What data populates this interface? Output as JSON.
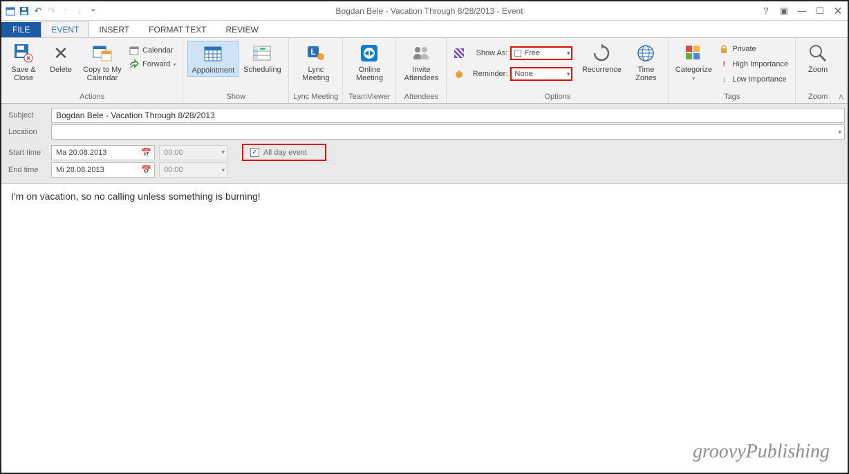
{
  "window": {
    "title": "Bogdan Bele - Vacation Through 8/28/2013 - Event"
  },
  "tabs": {
    "file": "FILE",
    "event": "EVENT",
    "insert": "INSERT",
    "format_text": "FORMAT TEXT",
    "review": "REVIEW"
  },
  "ribbon": {
    "actions": {
      "group": "Actions",
      "save_close": "Save & Close",
      "delete": "Delete",
      "copy_cal": "Copy to My Calendar",
      "calendar": "Calendar",
      "forward": "Forward"
    },
    "show": {
      "group": "Show",
      "appointment": "Appointment",
      "scheduling": "Scheduling"
    },
    "lync": {
      "group": "Lync Meeting",
      "btn": "Lync Meeting"
    },
    "tv": {
      "group": "TeamViewer",
      "btn": "Online Meeting"
    },
    "attendees": {
      "group": "Attendees",
      "btn": "Invite Attendees"
    },
    "options": {
      "group": "Options",
      "show_as_lbl": "Show As:",
      "show_as_val": "Free",
      "reminder_lbl": "Reminder:",
      "reminder_val": "None",
      "recurrence": "Recurrence",
      "time_zones": "Time Zones"
    },
    "tags": {
      "group": "Tags",
      "categorize": "Categorize",
      "private": "Private",
      "high": "High Importance",
      "low": "Low Importance"
    },
    "zoom": {
      "group": "Zoom",
      "btn": "Zoom"
    }
  },
  "form": {
    "subject_lbl": "Subject",
    "subject_val": "Bogdan Bele - Vacation Through 8/28/2013",
    "location_lbl": "Location",
    "location_val": "",
    "start_lbl": "Start time",
    "start_date": "Ma 20.08.2013",
    "start_time": "00:00",
    "end_lbl": "End time",
    "end_date": "Mi 28.08.2013",
    "end_time": "00:00",
    "all_day_lbl": "All day event",
    "all_day_checked": true
  },
  "body": {
    "text": "I'm on vacation, so no calling unless something is burning!"
  },
  "watermark": "groovyPublishing"
}
